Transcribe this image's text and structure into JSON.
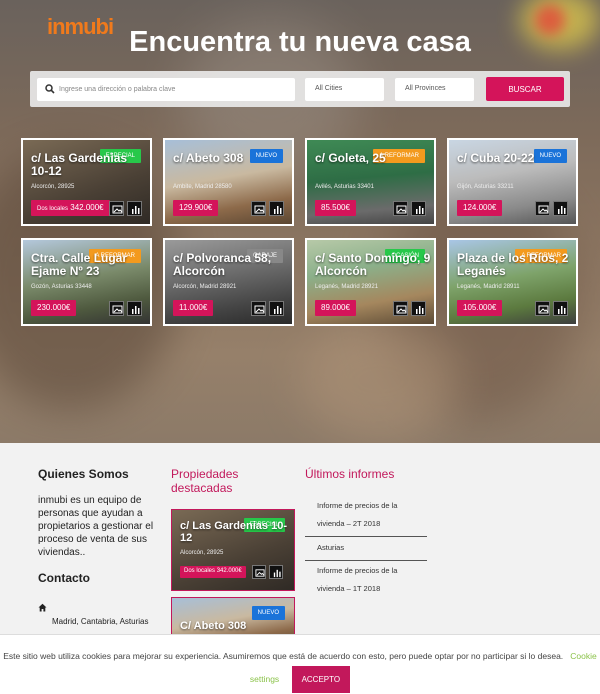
{
  "brand": {
    "logo": "inmubi",
    "accent": "#d4145a",
    "logo_color": "#f07a1c"
  },
  "hero": {
    "title": "Encuentra tu nueva casa"
  },
  "search": {
    "placeholder": "Ingrese una dirección o palabra clave",
    "cities": "All Cities",
    "provinces": "All Provinces",
    "button": "BUSCAR",
    "icon": "search-icon"
  },
  "listings": [
    {
      "title": "c/ Las Gardenias 10-12",
      "location": "Alcorcón, 28925",
      "price_prefix": "Dos locales",
      "price": "342.000€",
      "badge": "ESPECIAL",
      "badge_type": "especial"
    },
    {
      "title": "c/ Abeto 308",
      "location": "Ambite, Madrid 28580",
      "price_prefix": "",
      "price": "129.900€",
      "badge": "NUEVO",
      "badge_type": "nuevo"
    },
    {
      "title": "c/ Goleta, 25",
      "location": "Avilés, Asturias 33401",
      "price_prefix": "",
      "price": "85.500€",
      "badge": "A REFORMAR",
      "badge_type": "reformar"
    },
    {
      "title": "c/ Cuba 20-22",
      "location": "Gijón, Asturias 33211",
      "price_prefix": "",
      "price": "124.000€",
      "badge": "NUEVO",
      "badge_type": "nuevo"
    },
    {
      "title": "Ctra. Calle Lugar Ejame Nº 23",
      "location": "Gozón, Asturias 33448",
      "price_prefix": "",
      "price": "230.000€",
      "badge": "A REFORMAR",
      "badge_type": "reformar"
    },
    {
      "title": "c/ Polvoranca 58, Alcorcón",
      "location": "Alcorcón, Madrid 28921",
      "price_prefix": "",
      "price": "11.000€",
      "badge": "GARAJE",
      "badge_type": "garaje"
    },
    {
      "title": "c/ Santo Domingo, 9 Alcorcón",
      "location": "Leganés, Madrid 28921",
      "price_prefix": "",
      "price": "89.000€",
      "badge": "OCASIÓN",
      "badge_type": "especial"
    },
    {
      "title": "Plaza de los Ríos, 2 Leganés",
      "location": "Leganés, Madrid 28911",
      "price_prefix": "",
      "price": "105.000€",
      "badge": "A REFORMAR",
      "badge_type": "reformar"
    }
  ],
  "footer": {
    "about_title": "Quienes Somos",
    "about_text": "inmubi es un equipo de personas que ayudan a propietarios a gestionar el proceso de venta de sus viviendas..",
    "contact_title": "Contacto",
    "contact_address": "Madrid, Cantabria, Asturias",
    "featured_title": "Propiedades destacadas",
    "featured": [
      {
        "title": "c/ Las Gardenias 10-12",
        "location": "Alcorcón, 28925",
        "price_prefix": "Dos locales",
        "price": "342.000€",
        "badge": "ESPECIAL"
      },
      {
        "title": "C/ Abeto 308",
        "badge": "NUEVO"
      }
    ],
    "reports_title": "Últimos informes",
    "reports": [
      "Informe de precios de la vivienda – 2T 2018",
      "Asturias",
      "Informe de precios de la vivienda – 1T 2018"
    ]
  },
  "cookie": {
    "text": "Este sitio web utiliza cookies para mejorar su experiencia. Asumiremos que está de acuerdo con esto, pero puede optar por no participar si lo desea.",
    "settings": "Cookie settings",
    "accept": "ACCEPTO"
  }
}
